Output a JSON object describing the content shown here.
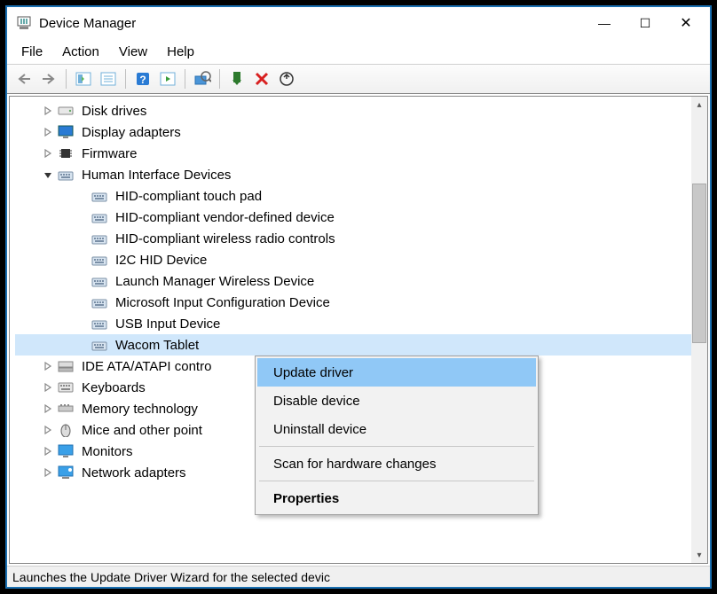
{
  "title": "Device Manager",
  "window_controls": {
    "min": "—",
    "max": "☐",
    "close": "✕"
  },
  "menubar": [
    "File",
    "Action",
    "View",
    "Help"
  ],
  "tree": {
    "items": [
      {
        "label": "Disk drives",
        "icon": "disk",
        "indent": 1,
        "exp": "collapsed"
      },
      {
        "label": "Display adapters",
        "icon": "display",
        "indent": 1,
        "exp": "collapsed"
      },
      {
        "label": "Firmware",
        "icon": "firmware",
        "indent": 1,
        "exp": "collapsed"
      },
      {
        "label": "Human Interface Devices",
        "icon": "hid",
        "indent": 1,
        "exp": "expanded"
      },
      {
        "label": "HID-compliant touch pad",
        "icon": "hid",
        "indent": 2,
        "exp": "none"
      },
      {
        "label": "HID-compliant vendor-defined device",
        "icon": "hid",
        "indent": 2,
        "exp": "none"
      },
      {
        "label": "HID-compliant wireless radio controls",
        "icon": "hid",
        "indent": 2,
        "exp": "none"
      },
      {
        "label": "I2C HID Device",
        "icon": "hid",
        "indent": 2,
        "exp": "none"
      },
      {
        "label": "Launch Manager Wireless Device",
        "icon": "hid",
        "indent": 2,
        "exp": "none"
      },
      {
        "label": "Microsoft Input Configuration Device",
        "icon": "hid",
        "indent": 2,
        "exp": "none"
      },
      {
        "label": "USB Input Device",
        "icon": "hid",
        "indent": 2,
        "exp": "none"
      },
      {
        "label": "Wacom Tablet",
        "icon": "hid",
        "indent": 2,
        "exp": "none",
        "selected": true
      },
      {
        "label": "IDE ATA/ATAPI contro",
        "icon": "ide",
        "indent": 1,
        "exp": "collapsed"
      },
      {
        "label": "Keyboards",
        "icon": "keyboard",
        "indent": 1,
        "exp": "collapsed"
      },
      {
        "label": "Memory technology",
        "icon": "memory",
        "indent": 1,
        "exp": "collapsed"
      },
      {
        "label": "Mice and other point",
        "icon": "mouse",
        "indent": 1,
        "exp": "collapsed"
      },
      {
        "label": "Monitors",
        "icon": "monitor",
        "indent": 1,
        "exp": "collapsed"
      },
      {
        "label": "Network adapters",
        "icon": "network",
        "indent": 1,
        "exp": "collapsed"
      }
    ]
  },
  "context_menu": {
    "items": [
      {
        "label": "Update driver",
        "highlight": true
      },
      {
        "label": "Disable device"
      },
      {
        "label": "Uninstall device"
      },
      {
        "sep": true
      },
      {
        "label": "Scan for hardware changes"
      },
      {
        "sep": true
      },
      {
        "label": "Properties",
        "bold": true
      }
    ]
  },
  "statusbar": "Launches the Update Driver Wizard for the selected devic"
}
